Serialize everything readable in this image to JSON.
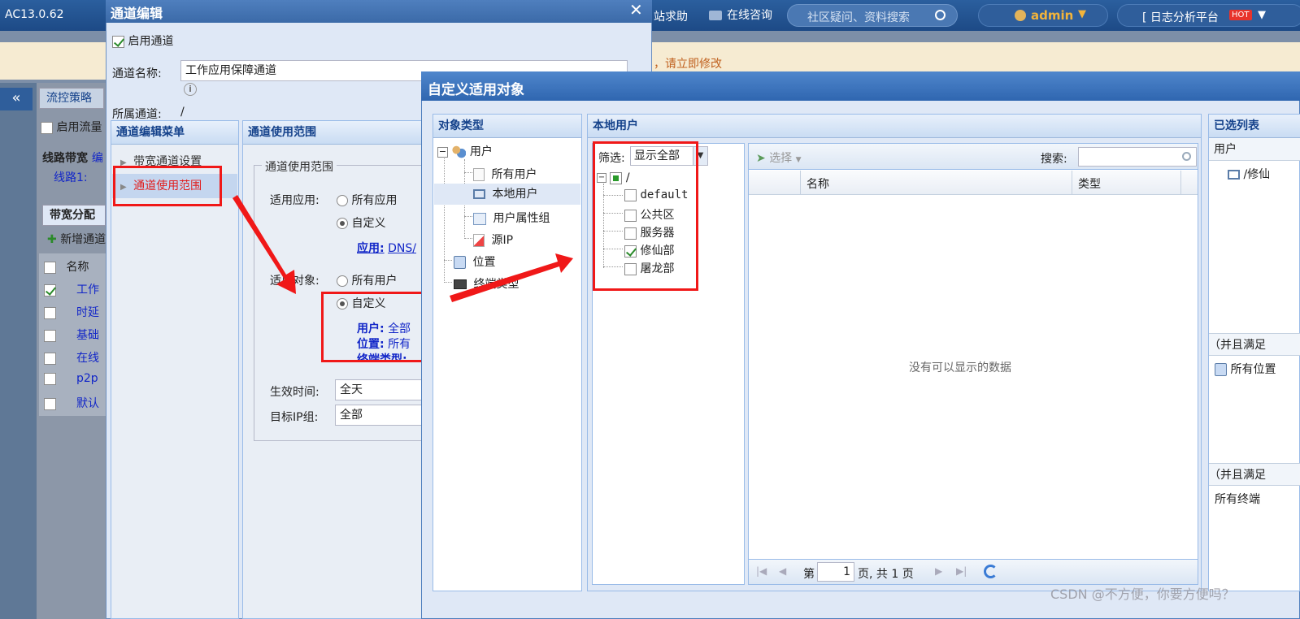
{
  "topbar": {
    "version": "AC13.0.62",
    "help": "站求助",
    "online": "在线咨询",
    "search_placeholder": "社区疑问、资料搜索",
    "user": "admin",
    "logplatform": "[ 日志分析平台",
    "hot": "HOT"
  },
  "notice": {
    "text": "，请立即修改"
  },
  "bg": {
    "tab_label": "流控策略",
    "enable_flow": "启用流量",
    "line_bw_label": "线路带宽",
    "line_bw_link": "编",
    "line1": "线路1:",
    "alloc_tab": "带宽分配",
    "add_channel": "新增通道",
    "col_name": "名称",
    "rows": [
      {
        "name": "工作",
        "checked": true
      },
      {
        "name": "时延",
        "checked": false
      },
      {
        "name": "基础",
        "checked": false
      },
      {
        "name": "在线",
        "checked": false
      },
      {
        "name": "p2p",
        "checked": false
      },
      {
        "name": "默认",
        "checked": false
      }
    ]
  },
  "channel_dialog": {
    "title": "通道编辑",
    "enable_label": "启用通道",
    "name_label": "通道名称:",
    "name_value": "工作应用保障通道",
    "parent_label": "所属通道:",
    "parent_value": "/",
    "menu_head": "通道编辑菜单",
    "menu_items": [
      "带宽通道设置",
      "通道使用范围"
    ],
    "scope_head": "通道使用范围",
    "scope_fieldset": "通道使用范围",
    "app_label": "适用应用:",
    "app_all": "所有应用",
    "app_custom": "自定义",
    "app_link_label": "应用:",
    "app_link_value": "DNS/",
    "obj_label": "适用对象:",
    "obj_all": "所有用户",
    "obj_custom": "自定义",
    "obj_user_label": "用户:",
    "obj_user_value": "全部",
    "obj_loc_label": "位置:",
    "obj_loc_value": "所有",
    "obj_term_label": "终端类型:",
    "time_label": "生效时间:",
    "time_value": "全天",
    "ipgroup_label": "目标IP组:",
    "ipgroup_value": "全部"
  },
  "object_dialog": {
    "title": "自定义适用对象",
    "type_head": "对象类型",
    "type_tree": {
      "root": "用户",
      "children": [
        "所有用户",
        "本地用户",
        "用户属性组",
        "源IP"
      ],
      "location": "位置",
      "terminal": "终端类型"
    },
    "local_head": "本地用户",
    "filter_label": "筛选:",
    "filter_value": "显示全部",
    "group_root": "/",
    "groups": [
      {
        "name": "default",
        "checked": false
      },
      {
        "name": "公共区",
        "checked": false
      },
      {
        "name": "服务器",
        "checked": false
      },
      {
        "name": "修仙部",
        "checked": true
      },
      {
        "name": "屠龙部",
        "checked": false
      }
    ],
    "select_btn": "选择",
    "search_label": "搜索:",
    "search_value": "",
    "col_name": "名称",
    "col_type": "类型",
    "empty": "没有可以显示的数据",
    "pager_prefix": "第",
    "pager_page": "1",
    "pager_suffix": "页, 共 1 页",
    "selected_head": "已选列表",
    "selected_user_head": "用户",
    "selected_user_item": "/修仙",
    "and_label_1": "（并且满足",
    "selected_loc_item": "所有位置",
    "and_label_2": "（并且满足",
    "selected_term_item": "所有终端"
  },
  "watermark": "CSDN @不方便，你要方便吗？"
}
